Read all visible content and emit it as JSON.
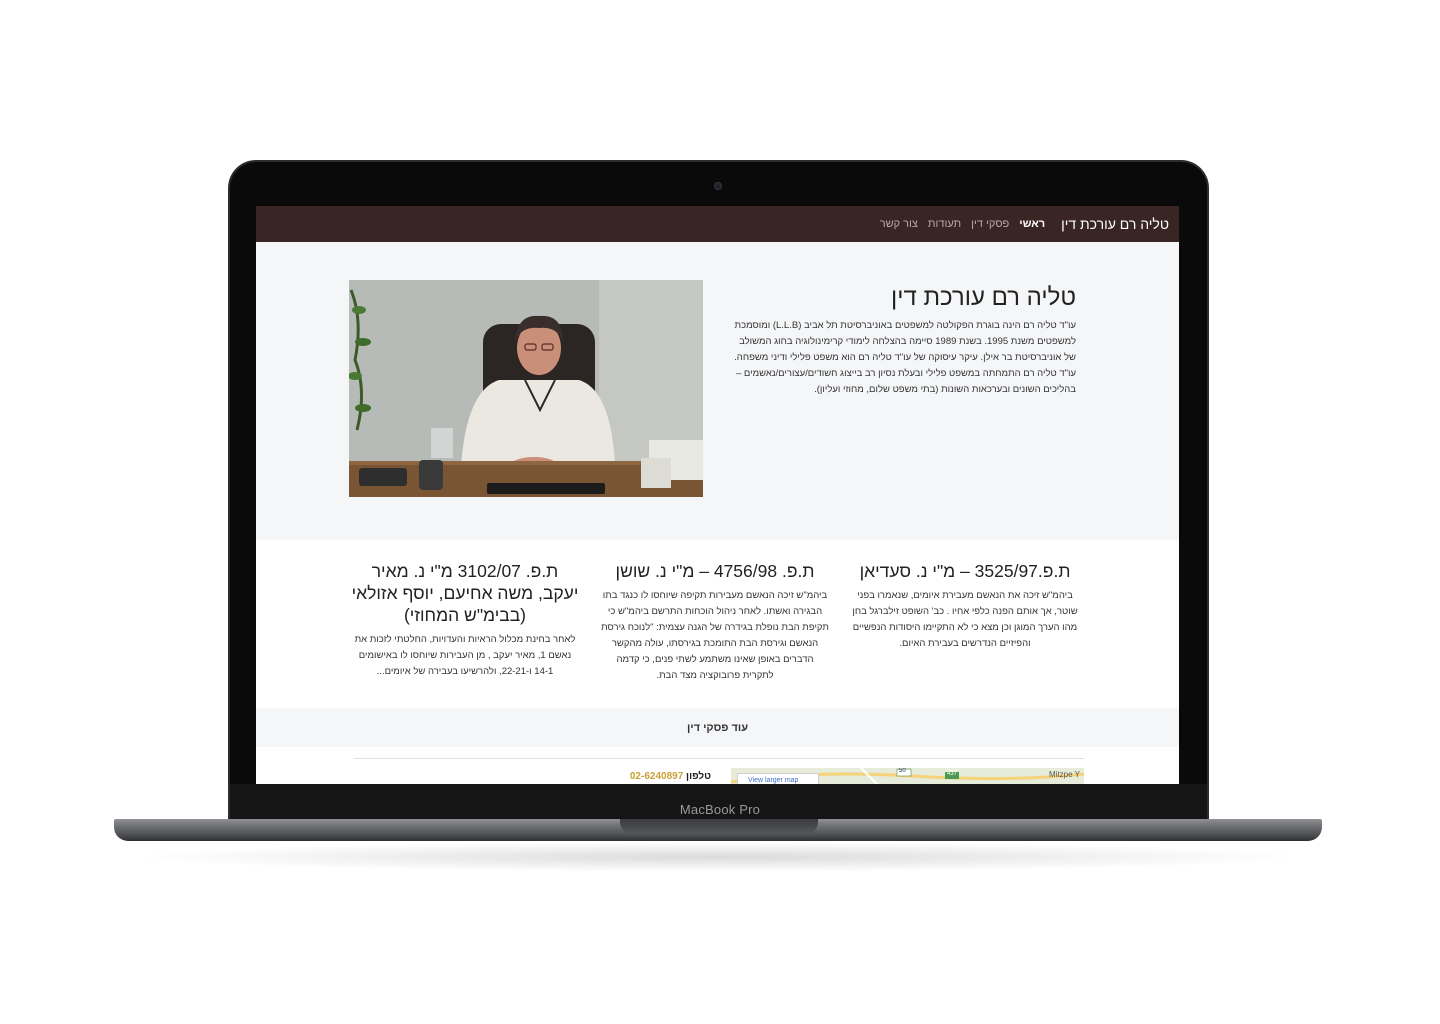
{
  "device": {
    "label": "MacBook Pro"
  },
  "navbar": {
    "brand": "טליה רם עורכת דין",
    "items": [
      {
        "label": "ראשי",
        "active": true
      },
      {
        "label": "פסקי דין",
        "active": false
      },
      {
        "label": "תעודות",
        "active": false
      },
      {
        "label": "צור קשר",
        "active": false
      }
    ]
  },
  "hero": {
    "title": "טליה רם עורכת דין",
    "text": "עו\"ד טליה רם הינה בוגרת הפקולטה למשפטים באוניברסיטת תל אביב (L.L.B) ומוסמכת למשפטים משנת 1995. בשנת 1989 סיימה בהצלחה לימודי קרימינולוגיה בחוג המשולב של אוניברסיטת בר אילן. עיקר עיסוקה של עו\"ד טליה רם הוא משפט פלילי ודיני משפחה. עו\"ד טליה רם התמחתה במשפט פלילי ובעלת נסיון רב בייצוג חשודים/עצורים/נאשמים – בהליכים השונים ובערכאות השונות (בתי משפט שלום, מחוזי ועליון).",
    "photo_alt": "עו\"ד טליה רם במשרדה"
  },
  "cases": [
    {
      "title": "ת.פ.3525/97 – מ\"י נ. סעדיאן",
      "text": "ביהמ\"ש זיכה את הנאשם מעבירת איומים, שנאמרו בפני שוטר, אך אותם הפנה כלפי אחיו . כב' השופט זילברגל בחן מהו הערך המוגן וכן מצא כי לא התקיימו היסודות הנפשיים והפיזיים הנדרשים בעבירת האיום."
    },
    {
      "title": "ת.פ. 4756/98 – מ\"י נ. שושן",
      "text": "ביהמ\"ש זיכה הנאשם מעבירות תקיפה שיוחסו לו כנגד בתו הבגירה ואשתו. לאחר ניהול הוכחות התרשם ביהמ\"ש כי תקיפת הבת נופלת בגידרה של הגנה עצמית: \"לנוכח גירסת הנאשם וגירסת הבת התומכת בגירסתו, עולה מהקשר הדברים באופן שאינו משתמע לשתי פנים, כי קדמה לתקרית פרובוקציה מצד הבת."
    },
    {
      "title": "ת.פ. 3102/07 מ\"י נ. מאיר יעקב, משה אחיעם, יוסף אזולאי (בבימ\"ש המחוזי)",
      "text": "לאחר בחינת מכלול הראיות והעדויות, החלטתי לזכות את נאשם 1, מאיר יעקב , מן העבירות שיוחסו לו באישומים 14-1 ו-22-21, ולהרשיעו בעבירה של איומים..."
    }
  ],
  "more_button": "עוד פסקי דין",
  "contact": {
    "label": "טלפון",
    "value": "02-6240897"
  },
  "map": {
    "link": "View larger map",
    "place": "Mitzpe Y",
    "road_a": "50",
    "road_b": "437"
  },
  "colors": {
    "navbar": "#3a2525",
    "accent": "#c9a038",
    "section_bg": "#f5f6f8"
  }
}
